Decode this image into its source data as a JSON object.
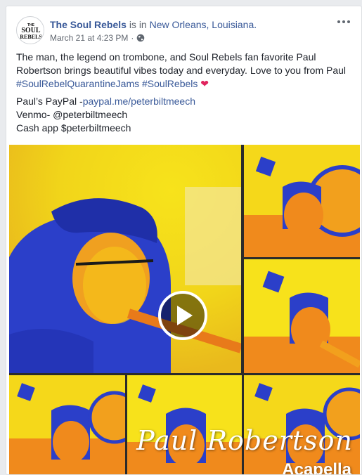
{
  "post": {
    "page_name": "The Soul Rebels",
    "is_in": "is in",
    "location": "New Orleans, Louisiana.",
    "timestamp": "March 21 at 4:23 PM",
    "separator": "·",
    "privacy_icon": "globe-icon",
    "avatar_text_top": "THE",
    "avatar_text_mid": "SOUL",
    "avatar_text_bottom": "REBELS",
    "more_icon": "more-options-icon",
    "text_line1": "The man, the legend on trombone, and Soul Rebels fan favorite Paul Robertson brings beautiful vibes today and everyday. Love to you from Paul ",
    "hashtag1": "#SoulRebelQuarantineJams",
    "hashtag2": "#SoulRebels",
    "heart": "❤",
    "paypal_label": "Paul’s PayPal -",
    "paypal_link": "paypal.me/peterbiltmeech",
    "venmo": "Venmo- @peterbiltmeech",
    "cashapp": "Cash app $peterbiltmeech"
  },
  "video": {
    "overlay_name": "Paul Robertson",
    "overlay_sub": "Acapella",
    "play_icon": "play-icon"
  },
  "colors": {
    "link": "#385898",
    "yellow": "#f5e21a",
    "orange": "#f08a1c",
    "blue": "#2b3fc9",
    "heart": "#e0245e"
  }
}
